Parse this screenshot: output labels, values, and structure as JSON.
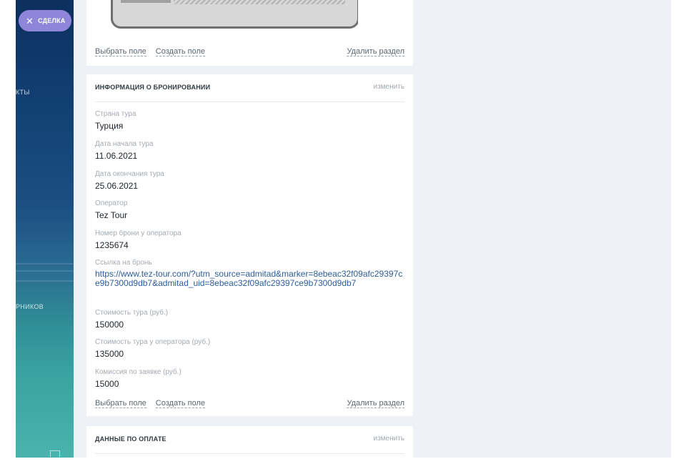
{
  "nav": {
    "deal_label": "СДЕЛКА",
    "item_contacts_partial": "КТЫ",
    "item_employees_partial": "РНИКОВ",
    "close_icon": "close-icon"
  },
  "top_card": {
    "select_field": "Выбрать поле",
    "create_field": "Создать поле",
    "delete_section": "Удалить раздел"
  },
  "booking": {
    "title": "ИНФОРМАЦИЯ О БРОНИРОВАНИИ",
    "edit": "изменить",
    "fields": [
      {
        "label": "Страна тура",
        "value": "Турция"
      },
      {
        "label": "Дата начала тура",
        "value": "11.06.2021"
      },
      {
        "label": "Дата окончания тура",
        "value": "25.06.2021"
      },
      {
        "label": "Оператор",
        "value": "Tez Tour"
      },
      {
        "label": "Номер брони у оператора",
        "value": "1235674"
      },
      {
        "label": "Ссылка на бронь",
        "value": "https://www.tez-tour.com/?utm_source=admitad&marker=8ebeac32f09afc29397ce9b7300d9db7&admitad_uid=8ebeac32f09afc29397ce9b7300d9db7"
      },
      {
        "label": "Стоимость тура (руб.)",
        "value": "150000"
      },
      {
        "label": "Стоимость тура у оператора (руб.)",
        "value": "135000"
      },
      {
        "label": "Комиссия по заявке (руб.)",
        "value": "15000"
      }
    ],
    "select_field": "Выбрать поле",
    "create_field": "Создать поле",
    "delete_section": "Удалить раздел"
  },
  "payment": {
    "title": "ДАННЫЕ ПО ОПЛАТЕ",
    "edit": "изменить"
  },
  "colors": {
    "accent_pill": "#8f86d9",
    "link": "#2d5d9a",
    "page_bg": "#eef1f5"
  }
}
